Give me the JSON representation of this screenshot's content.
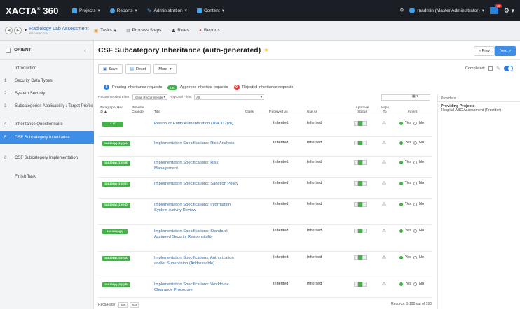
{
  "topnav": {
    "brand": "XACTA",
    "brand_num": "360",
    "menu": [
      {
        "label": "Projects",
        "icon": "projects-icon",
        "color": "#4aa3e8"
      },
      {
        "label": "Reports",
        "icon": "reports-icon",
        "color": "#4aa3e8"
      },
      {
        "label": "Administration",
        "icon": "administration-icon",
        "color": "#4aa3e8"
      },
      {
        "label": "Content",
        "icon": "content-icon",
        "color": "#4aa3e8"
      }
    ],
    "user": "rnadmin (Master Administrator)",
    "badge": "48"
  },
  "subnav": {
    "project_title": "Radiology Lab Assessment",
    "project_sub": "RAD-ABC1234",
    "items": [
      "Tasks",
      "Process Steps",
      "Roles",
      "Reports"
    ]
  },
  "sidebar": {
    "header": "ORIENT",
    "items": [
      {
        "num": "",
        "label": "Introduction"
      },
      {
        "num": "1",
        "label": "Security Data Types"
      },
      {
        "num": "2",
        "label": "System Security"
      },
      {
        "num": "3",
        "label": "Subcategories Applicability / Target Profile"
      },
      {
        "num": "4",
        "label": "Inheritance Questionnaire"
      },
      {
        "num": "5",
        "label": "CSF Subcategory Inheritance"
      },
      {
        "num": "6",
        "label": "CSF Subcategory Implementation"
      },
      {
        "num": "",
        "label": "Finish Task"
      }
    ]
  },
  "main": {
    "title": "CSF Subcategory Inheritance (auto-generated)",
    "prev_label": "« Prev",
    "next_label": "Next »",
    "toolbar": {
      "save": "Save",
      "reset": "Reset",
      "more": "More"
    },
    "completed_label": "Completed:",
    "legend": {
      "pending": "Pending inheritance requests",
      "pending_count": "0",
      "approved": "Approved inherited requests",
      "approved_count": "190",
      "rejected": "Rejected inheritance requests",
      "rejected_count": "0"
    },
    "filters": {
      "recommended_label": "Recommended Filter:",
      "recommended_value": "Show Recommende",
      "approval_label": "Approval Filter:",
      "approval_value": "All"
    },
    "columns": {
      "paragraph": "Paragraph/ Req ID ▲",
      "provider_change": "Provider Change",
      "title": "Title",
      "class": "Class",
      "received_as": "Received As",
      "use_as": "Use As",
      "approval_status": "Approval Status",
      "maps_to": "Maps To",
      "inherit": "Inherit"
    },
    "rows": [
      {
        "req": "4.17",
        "title": "Person or Entity Authentication (164.312(d))",
        "received": "Inherited",
        "use": "Inherited",
        "yes": "Yes",
        "no": "No"
      },
      {
        "req": "164.308(a) (1)(ii)(A)",
        "title": "Implementation Specifications: Risk Analysis",
        "received": "Inherited",
        "use": "Inherited",
        "yes": "Yes",
        "no": "No"
      },
      {
        "req": "164.308(a) (1)(ii)(B)",
        "title": "Implementation Specifications: Risk Management",
        "received": "Inherited",
        "use": "Inherited",
        "yes": "Yes",
        "no": "No"
      },
      {
        "req": "164.308(a) (1)(ii)(C)",
        "title": "Implementation Specifications: Sanction Policy",
        "received": "Inherited",
        "use": "Inherited",
        "yes": "Yes",
        "no": "No"
      },
      {
        "req": "164.308(a) (1)(ii)(D)",
        "title": "Implementation Specifications: Information System Activity Review",
        "received": "Inherited",
        "use": "Inherited",
        "yes": "Yes",
        "no": "No"
      },
      {
        "req": "164.308(a)(2)",
        "title": "Implementation Specifications: Standard: Assigned Security Responsibility",
        "received": "Inherited",
        "use": "Inherited",
        "yes": "Yes",
        "no": "No"
      },
      {
        "req": "164.308(a) (3)(ii)(A)",
        "title": "Implementation Specifications: Authorization and/or Supervision (Addressable)",
        "received": "Inherited",
        "use": "Inherited",
        "yes": "Yes",
        "no": "No"
      },
      {
        "req": "164.308(a) (3)(ii)(B)",
        "title": "Implementation Specifications: Workforce Clearance Procedure",
        "received": "Inherited",
        "use": "Inherited",
        "yes": "Yes",
        "no": "No"
      }
    ],
    "footer": {
      "recs_label": "Recs/Page:",
      "recs_value": "200",
      "set_label": "Set",
      "records": "Records: 1-190 out of 190"
    }
  },
  "providers": {
    "header": "Providers",
    "title": "Providing Projects",
    "text": "Hospital ABC Assessment (Provider)"
  }
}
